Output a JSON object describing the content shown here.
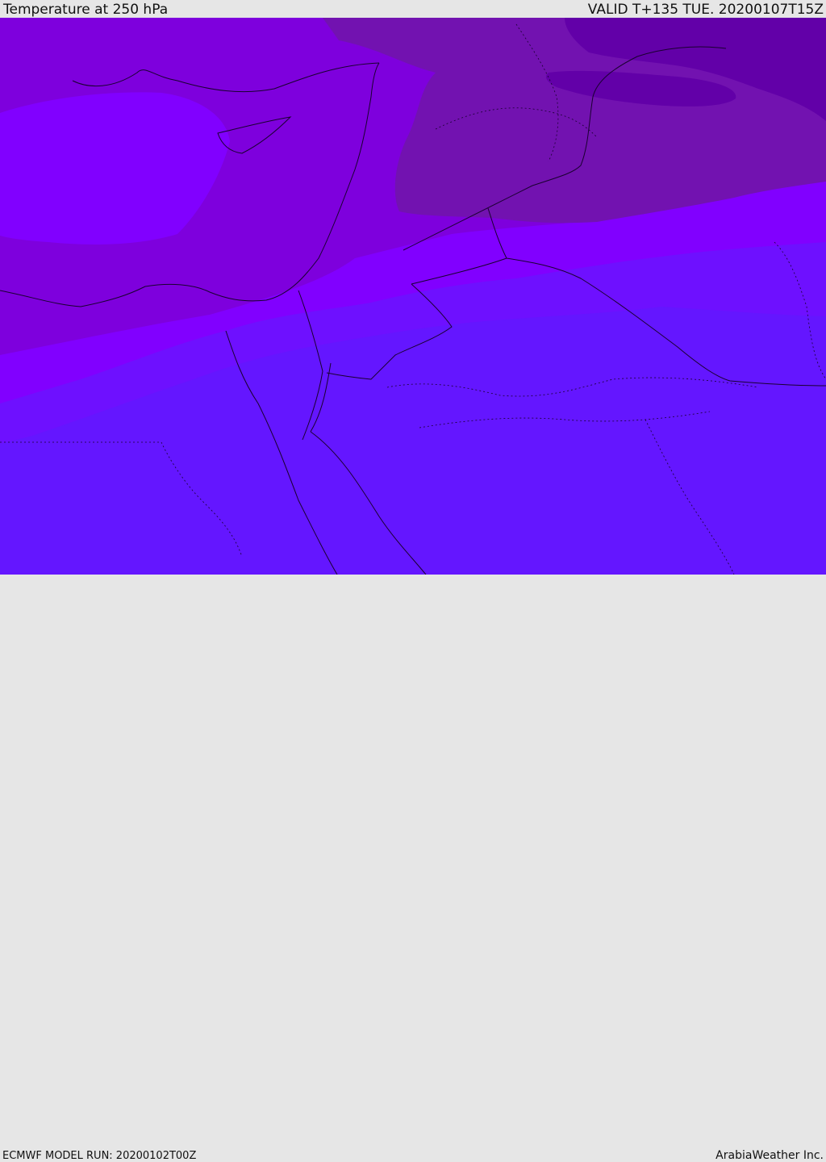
{
  "header": {
    "title": "Temperature at 250 hPa",
    "valid": "VALID T+135 TUE. 20200107T15Z"
  },
  "footer": {
    "model_run": "ECMWF MODEL RUN: 20200102T00Z",
    "brand": "ArabiaWeather Inc."
  },
  "map": {
    "field": "temperature",
    "level": "250 hPa",
    "palette": {
      "darkest": "#6200a8",
      "dark": "#7212b0",
      "mid": "#7e00dd",
      "bright": "#8100ff",
      "blueviolet": "#6e10ff",
      "blue": "#6416ff",
      "coastline": "#1a0030"
    }
  }
}
